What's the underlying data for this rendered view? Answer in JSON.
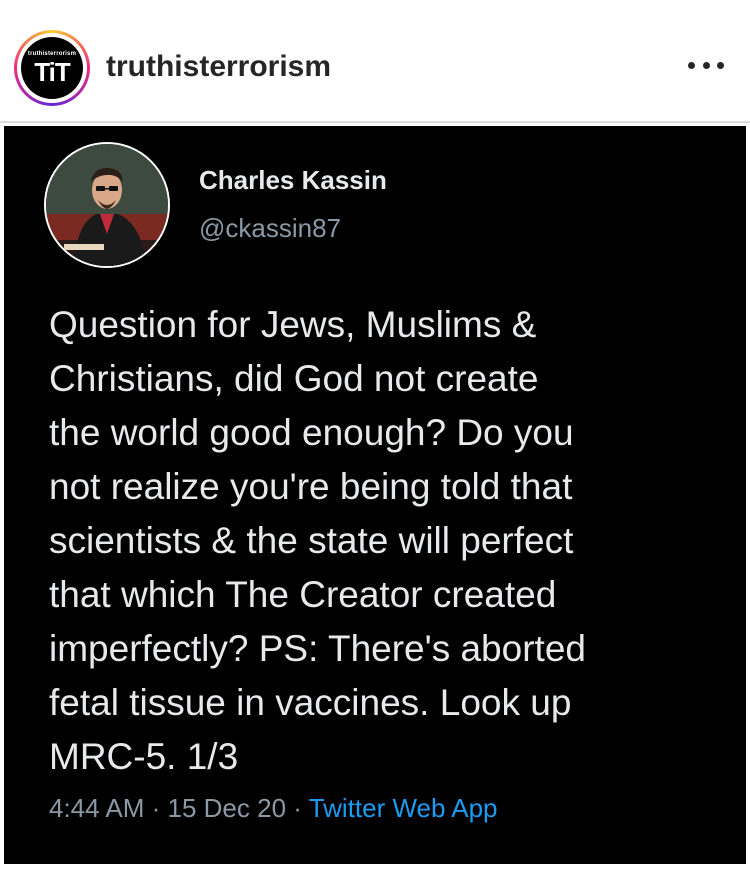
{
  "post": {
    "account": {
      "username": "truthisterrorism",
      "logo_small_text": "truthisterrorism",
      "logo_big_text": "TiT"
    },
    "more_icon": "more-horizontal-icon"
  },
  "tweet": {
    "display_name": "Charles Kassin",
    "handle": "@ckassin87",
    "text": "Question for Jews, Muslims &\nChristians, did God not create\nthe world good enough? Do you\nnot realize you're being told that\nscientists & the state will perfect\nthat which The Creator created\nimperfectly? PS: There's aborted\nfetal tissue in vaccines. Look up\nMRC-5. 1/3",
    "time": "4:44 AM",
    "date": "15 Dec 20",
    "separator": " · ",
    "source": "Twitter Web App"
  },
  "colors": {
    "tweet_background": "#000000",
    "tweet_text": "#e7e9ea",
    "tweet_secondary": "#8b98a5",
    "link": "#1d9bf0",
    "instagram_text": "#262626"
  }
}
